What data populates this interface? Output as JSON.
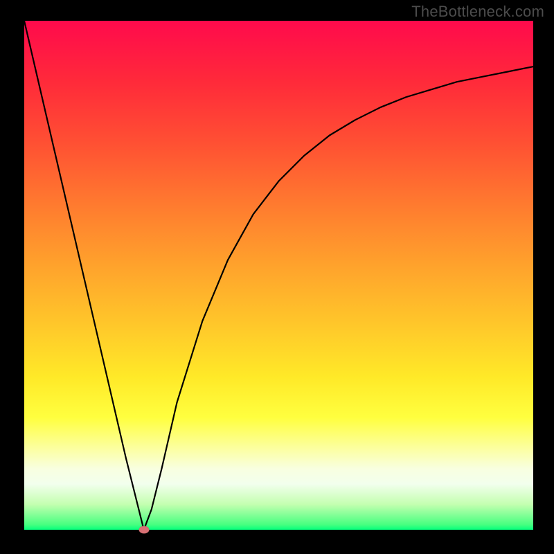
{
  "watermark": "TheBottleneck.com",
  "chart_data": {
    "type": "line",
    "title": "",
    "xlabel": "",
    "ylabel": "",
    "xlim": [
      0,
      100
    ],
    "ylim": [
      0,
      100
    ],
    "grid": false,
    "background_gradient": [
      "#ff0a4c",
      "#ffff3f",
      "#05ff7c"
    ],
    "series": [
      {
        "name": "bottleneck-curve",
        "x": [
          0,
          5,
          10,
          15,
          20,
          23.5,
          25,
          27,
          30,
          35,
          40,
          45,
          50,
          55,
          60,
          65,
          70,
          75,
          80,
          85,
          90,
          95,
          100
        ],
        "values": [
          100,
          78.5,
          57,
          35.5,
          14,
          0,
          4,
          12,
          25,
          41,
          53,
          62,
          68.5,
          73.5,
          77.5,
          80.5,
          83,
          85,
          86.5,
          88,
          89,
          90,
          91
        ]
      }
    ],
    "marker": {
      "x": 23.5,
      "y": 0,
      "color": "#d87074"
    }
  }
}
